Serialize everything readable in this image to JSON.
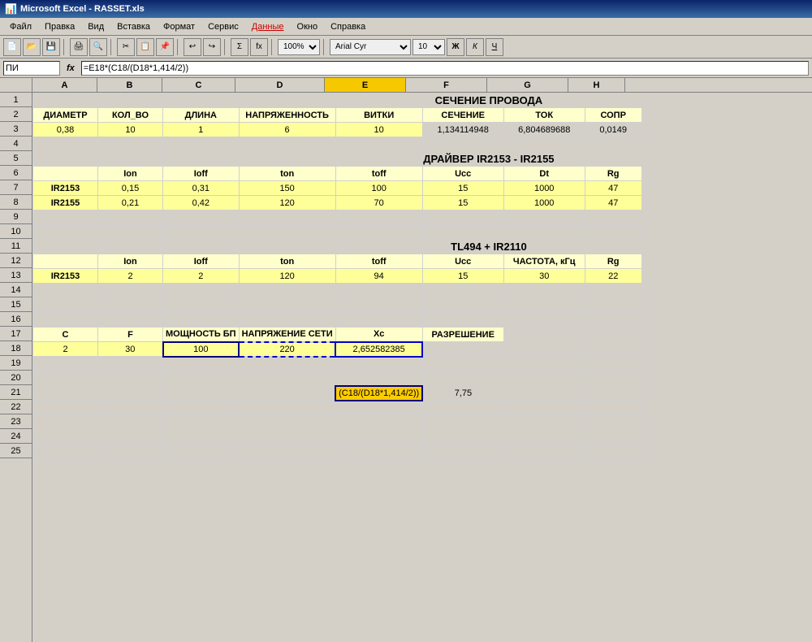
{
  "titleBar": {
    "icon": "📊",
    "text": "Microsoft Excel - RASSET.xls"
  },
  "menuBar": {
    "items": [
      "Файл",
      "Правка",
      "Вид",
      "Вставка",
      "Формат",
      "Сервис",
      "Данные",
      "Окно",
      "Справка"
    ]
  },
  "formulaBar": {
    "nameBox": "ПИ",
    "formula": "=E18*(C18/(D18*1,414/2))"
  },
  "columns": [
    "A",
    "B",
    "C",
    "D",
    "E",
    "F",
    "G",
    "H"
  ],
  "rows": {
    "row1": {
      "title": "СЕЧЕНИЕ ПРОВОДА"
    },
    "row2": {
      "headers": [
        "ДИАМЕТР",
        "КОЛ_ВО",
        "ДЛИНА",
        "НАПРЯЖЕННОСТЬ",
        "ВИТКИ",
        "СЕЧЕНИЕ",
        "ТОК",
        "СОПР"
      ]
    },
    "row3": {
      "cells": [
        "0,38",
        "10",
        "1",
        "6",
        "10",
        "1,134114948",
        "6,804689688",
        "0,0149"
      ]
    },
    "row5": {
      "title": "ДРАЙВЕР IR2153 - IR2155"
    },
    "row6": {
      "headers": [
        "",
        "Ion",
        "Ioff",
        "ton",
        "toff",
        "Ucc",
        "Dt",
        "Rg"
      ]
    },
    "row7": {
      "cells": [
        "IR2153",
        "0,15",
        "0,31",
        "150",
        "100",
        "15",
        "1000",
        "47"
      ]
    },
    "row8": {
      "cells": [
        "IR2155",
        "0,21",
        "0,42",
        "120",
        "70",
        "15",
        "1000",
        "47"
      ]
    },
    "row11": {
      "title": "TL494 + IR2110"
    },
    "row12": {
      "headers": [
        "",
        "Ion",
        "Ioff",
        "ton",
        "toff",
        "Ucc",
        "ЧАСТОТА, кГц",
        "Rg"
      ]
    },
    "row13": {
      "cells": [
        "IR2153",
        "2",
        "2",
        "120",
        "94",
        "15",
        "30",
        "22"
      ]
    },
    "row17": {
      "headers": [
        "C",
        "F",
        "МОЩНОСТЬ БП",
        "НАПРЯЖЕНИЕ СЕТИ",
        "Хс",
        "РАЗРЕШЕНИЕ",
        "",
        ""
      ]
    },
    "row18": {
      "cells": [
        "2",
        "30",
        "100",
        "220",
        "2,652582385",
        "",
        "",
        ""
      ]
    },
    "row21": {
      "formula": "(C18/(D18*1,414/2))",
      "result": "7,75"
    }
  },
  "zoom": "100%",
  "font": "Arial Cyr",
  "fontSize": "10"
}
